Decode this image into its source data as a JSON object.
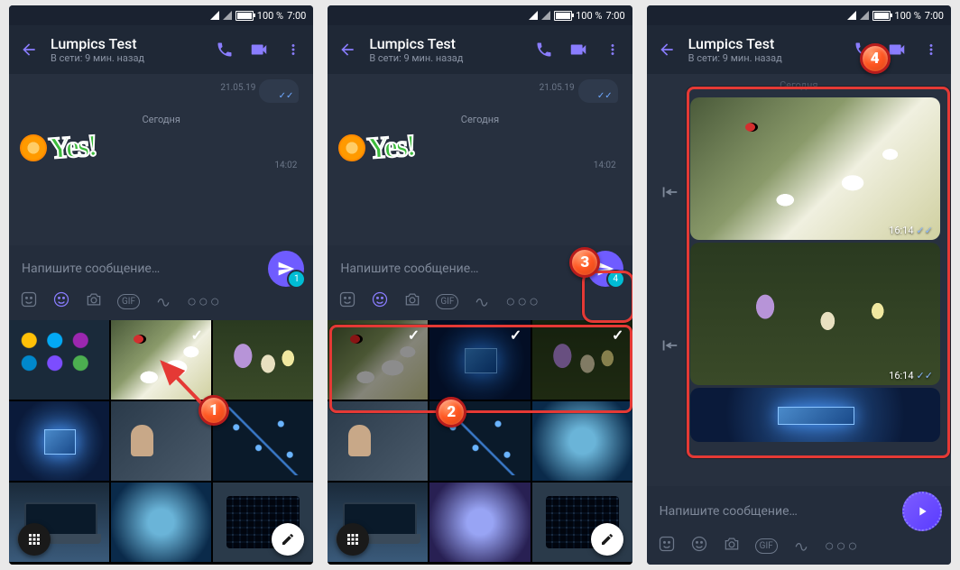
{
  "status": {
    "battery_pct": "100 %",
    "time": "7:00"
  },
  "header": {
    "contact_name": "Lumpics Test",
    "presence": "В сети: 9 мин. назад"
  },
  "chat": {
    "prev_date": "21.05.19",
    "today_label": "Сегодня",
    "sticker_text": "Yes!",
    "sticker_time": "14:02"
  },
  "composer": {
    "placeholder": "Напишите сообщение…"
  },
  "badges": {
    "p1_count": "1",
    "p2_count": "4"
  },
  "msg": {
    "t1": "16:14",
    "t2": "16:14"
  },
  "callouts": {
    "c1": "1",
    "c2": "2",
    "c3": "3",
    "c4": "4"
  }
}
